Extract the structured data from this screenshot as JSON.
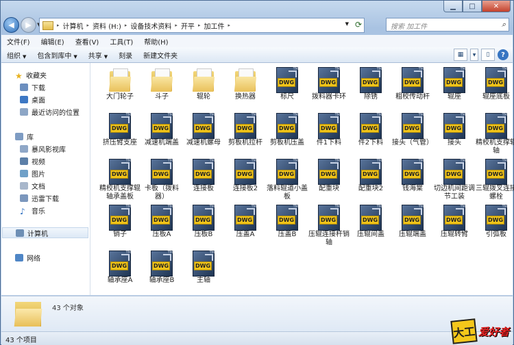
{
  "address": {
    "crumbs": [
      "计算机",
      "资料 (H:)",
      "设备技术资料",
      "开平",
      "加工件"
    ]
  },
  "search": {
    "placeholder": "搜索 加工件"
  },
  "menu": [
    "文件(F)",
    "编辑(E)",
    "查看(V)",
    "工具(T)",
    "帮助(H)"
  ],
  "commands": {
    "organize": "组织",
    "include": "包含到库中",
    "share": "共享",
    "burn": "刻录",
    "new_folder": "新建文件夹"
  },
  "sidebar": {
    "favorites": "收藏夹",
    "fav_items": [
      "下载",
      "桌面",
      "最近访问的位置"
    ],
    "libraries": "库",
    "lib_items": [
      "暴风影视库",
      "视频",
      "图片",
      "文档",
      "迅雷下载",
      "音乐"
    ],
    "computer": "计算机",
    "network": "网络"
  },
  "files": [
    {
      "name": "大门轮子",
      "type": "folder"
    },
    {
      "name": "斗子",
      "type": "folder"
    },
    {
      "name": "辊轮",
      "type": "folder"
    },
    {
      "name": "换热器",
      "type": "folder"
    },
    {
      "name": "标尺",
      "type": "dwg"
    },
    {
      "name": "拨料器卡环",
      "type": "dwg"
    },
    {
      "name": "除锈",
      "type": "dwg"
    },
    {
      "name": "粗校传动杆",
      "type": "dwg"
    },
    {
      "name": "辊座",
      "type": "dwg"
    },
    {
      "name": "辊座底板",
      "type": "dwg"
    },
    {
      "name": "挤压臂支座",
      "type": "dwg"
    },
    {
      "name": "减速机端盖",
      "type": "dwg"
    },
    {
      "name": "减速机螺母",
      "type": "dwg"
    },
    {
      "name": "剪板机拉杆",
      "type": "dwg"
    },
    {
      "name": "剪板机压盖",
      "type": "dwg"
    },
    {
      "name": "件1下料",
      "type": "dwg"
    },
    {
      "name": "件2下料",
      "type": "dwg"
    },
    {
      "name": "接头（气管）",
      "type": "dwg"
    },
    {
      "name": "接头",
      "type": "dwg"
    },
    {
      "name": "精校机支撑辊轴",
      "type": "dwg"
    },
    {
      "name": "精校机支撑辊轴承盖板",
      "type": "dwg"
    },
    {
      "name": "卡板（拨料器）",
      "type": "dwg"
    },
    {
      "name": "连接板",
      "type": "dwg"
    },
    {
      "name": "连接板2",
      "type": "dwg"
    },
    {
      "name": "落料辊道小盖板",
      "type": "dwg"
    },
    {
      "name": "配重块",
      "type": "dwg"
    },
    {
      "name": "配重块2",
      "type": "dwg"
    },
    {
      "name": "钱海棠",
      "type": "dwg"
    },
    {
      "name": "切边机间距调节工装",
      "type": "dwg"
    },
    {
      "name": "三辊拨叉连接螺栓",
      "type": "dwg"
    },
    {
      "name": "销子",
      "type": "dwg"
    },
    {
      "name": "压板A",
      "type": "dwg"
    },
    {
      "name": "压板B",
      "type": "dwg"
    },
    {
      "name": "压盖A",
      "type": "dwg"
    },
    {
      "name": "压盖B",
      "type": "dwg"
    },
    {
      "name": "压辊连接杆销轴",
      "type": "dwg"
    },
    {
      "name": "压辊间盖",
      "type": "dwg"
    },
    {
      "name": "压辊端盖",
      "type": "dwg"
    },
    {
      "name": "压辊转臂",
      "type": "dwg"
    },
    {
      "name": "引弧板",
      "type": "dwg"
    },
    {
      "name": "轴承座A",
      "type": "dwg"
    },
    {
      "name": "轴承座B",
      "type": "dwg"
    },
    {
      "name": "主轴",
      "type": "dwg"
    }
  ],
  "dwg_badge": "DWG",
  "dwg_tm": "TM",
  "details": {
    "count": "43 个对象"
  },
  "status": {
    "text": "43 个项目"
  },
  "watermark": {
    "a": "大工",
    "b": "爱好者"
  },
  "colors": {
    "selection": "#dde9f6",
    "dwg_badge": "#f0c419",
    "folder": "#e9c15a"
  }
}
